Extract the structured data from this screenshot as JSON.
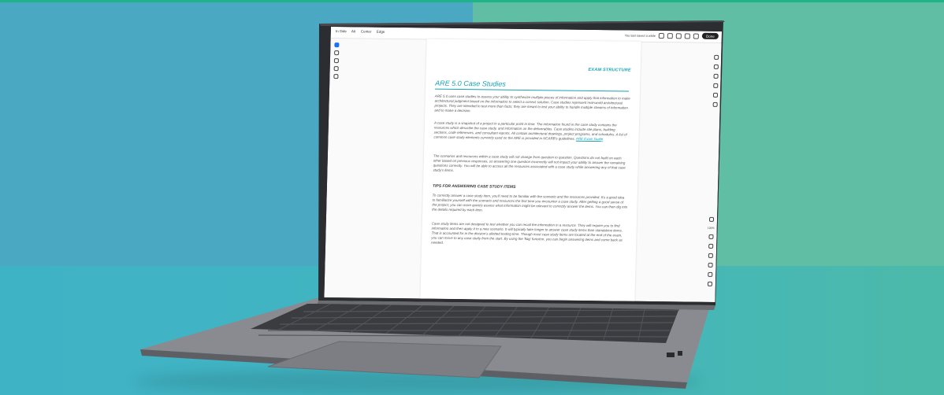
{
  "app": {
    "menu": [
      "In Side",
      "Alt",
      "Center",
      "Edge"
    ],
    "status_text": "You last saved a while",
    "done_label": "Done",
    "zoom_label": "100%"
  },
  "document": {
    "header": "EXAM STRUCTURE",
    "title": "ARE 5.0 Case Studies",
    "paragraphs": [
      "ARE 5.0 uses case studies to assess your ability to synthesize multiple pieces of information and apply that information to make architectural judgment based on the information to select a correct solution. Case studies represent real-world architectural projects. They are intended to test more than facts; they are meant to test your ability to handle multiple streams of information and to make a decision.",
      "A case study is a snapshot of a project in a particular point in time. The information found in the case study contains the resources which describe the case study, and information on the deliverables. Case studies include site plans, building sections, code references, and consultant reports. All contain architectural drawings, project programs, and schedules. A list of common case study elements currently used on the ARE is provided in NCARB's guidelines.",
      "The scenarios and resources within a case study will not change from question to question. Questions do not build on each other based on previous responses, so answering one question incorrectly will not impact your ability to answer the remaining questions correctly. You will be able to access all the resources associated with a case study while answering any of that case study's items."
    ],
    "link_text": "ARE Exam Guide",
    "section_title": "TIPS FOR ANSWERING CASE STUDY ITEMS",
    "tip_paragraphs": [
      "To correctly answer a case study item, you'll need to be familiar with the scenario and the resources provided. It's a good idea to familiarize yourself with the scenario and resources the first time you encounter a case study. After getting a good sense of the project, you can more quickly assess what information might be relevant to correctly answer the items. You can then dig into the details required by each item.",
      "Case study items are not designed to test whether you can recall the information in a resource. They will require you to find information and then apply it to a new scenario. It will typically take longer to answer case study items than standalone items. That is accounted for in the division's allotted testing time. Though most case study items are located at the end of the exam, you can move to any case study from the start. By using the 'flag' function, you can begin answering items and come back as needed."
    ]
  }
}
